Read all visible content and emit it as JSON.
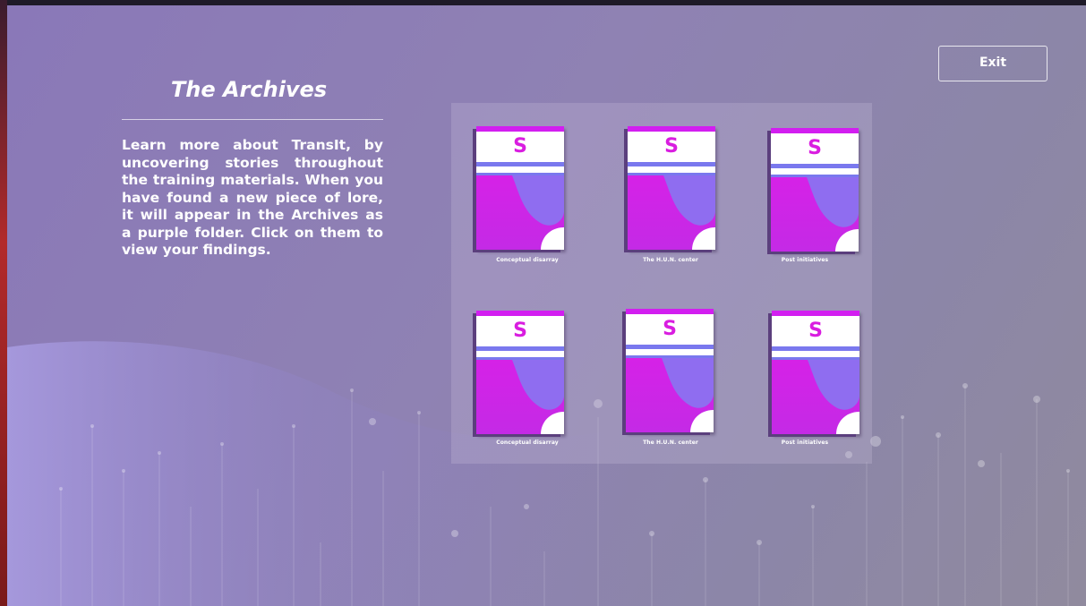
{
  "window": {
    "accent": "#8a78b8",
    "edge_color": "#b22a2a"
  },
  "archives": {
    "title": "The Archives",
    "description": "Learn more about TransIt, by uncovering stories throughout the training materials. When you have found a new piece of lore, it will appear in the Archives as a purple folder. Click on them to view your findings."
  },
  "toolbar": {
    "exit_label": "Exit"
  },
  "folders": [
    {
      "logo": "S",
      "caption": "Conceptual disarray",
      "icon": "folder-icon"
    },
    {
      "logo": "S",
      "caption": "The H.U.N. center",
      "icon": "folder-icon"
    },
    {
      "logo": "S",
      "caption": "Post initiatives",
      "icon": "folder-icon"
    },
    {
      "logo": "S",
      "caption": "Conceptual disarray",
      "icon": "folder-icon"
    },
    {
      "logo": "S",
      "caption": "The H.U.N. center",
      "icon": "folder-icon"
    },
    {
      "logo": "S",
      "caption": "Post initiatives",
      "icon": "folder-icon"
    }
  ],
  "colors": {
    "folder_magenta": "#e11ce8",
    "folder_blue": "#7a78ee",
    "logo": "#d91de0"
  }
}
